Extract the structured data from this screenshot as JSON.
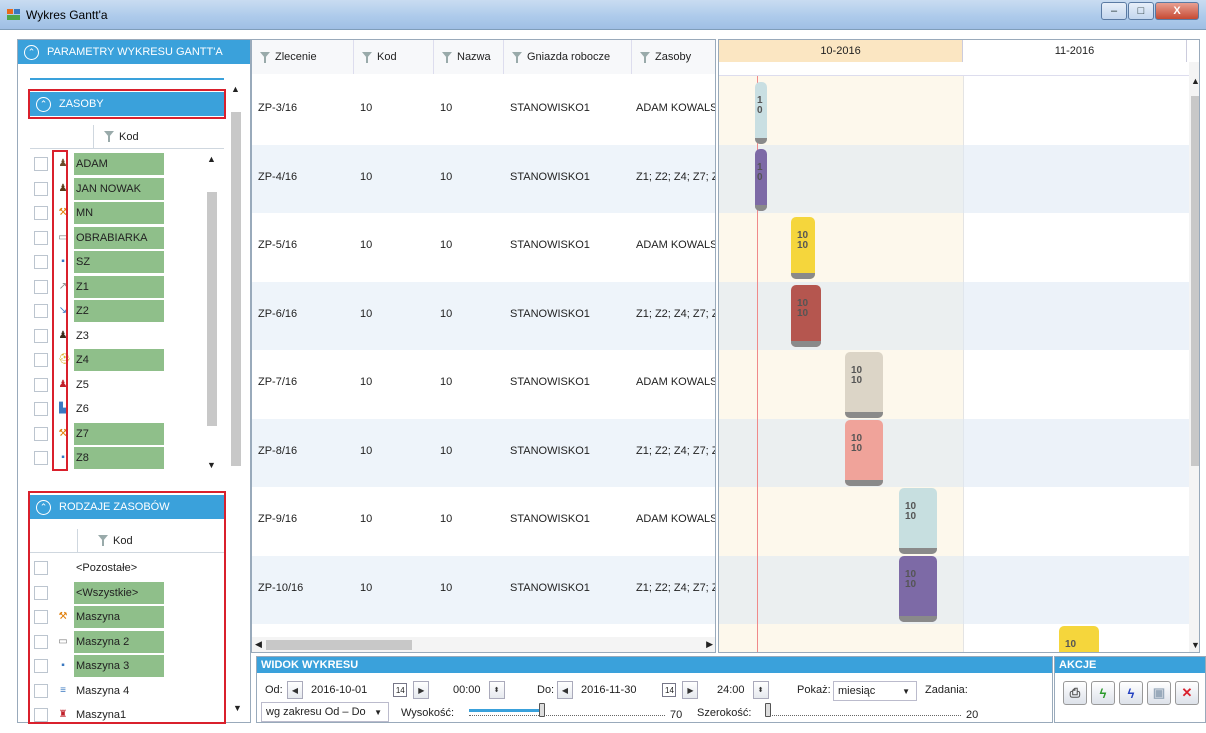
{
  "window": {
    "title": "Wykres Gantt'a",
    "minimize": "–",
    "maximize": "□",
    "close": "X"
  },
  "left": {
    "params_title": "PARAMETRY WYKRESU GANTT'A",
    "zasoby": {
      "title": "ZASOBY",
      "col": "Kod",
      "rows": [
        {
          "label": "ADAM KOWALSKI",
          "icon": "person-icon",
          "glyph": "♟",
          "color": "#6b4a2a",
          "green": true
        },
        {
          "label": "JAN NOWAK",
          "icon": "person-icon",
          "glyph": "♟",
          "color": "#5a3a1a",
          "green": true
        },
        {
          "label": "MN",
          "icon": "machine-icon",
          "glyph": "⚒",
          "color": "#e07a00",
          "green": true
        },
        {
          "label": "OBRABIARKA",
          "icon": "lathe-icon",
          "glyph": "▭",
          "color": "#777777",
          "green": true
        },
        {
          "label": "SZ",
          "icon": "device-icon",
          "glyph": "▪",
          "color": "#3a78c0",
          "green": true
        },
        {
          "label": "Z1",
          "icon": "tool-icon",
          "glyph": "↗",
          "color": "#888888",
          "green": true
        },
        {
          "label": "Z2",
          "icon": "tool-icon",
          "glyph": "↘",
          "color": "#3a78c0",
          "green": true
        },
        {
          "label": "Z3",
          "icon": "person-icon",
          "glyph": "♟",
          "color": "#3a2a1a",
          "green": false
        },
        {
          "label": "Z4",
          "icon": "worker-icon",
          "glyph": "⛑",
          "color": "#d4a000",
          "green": true
        },
        {
          "label": "Z5",
          "icon": "person-icon",
          "glyph": "♟",
          "color": "#c0202a",
          "green": false
        },
        {
          "label": "Z6",
          "icon": "chart-icon",
          "glyph": "▙",
          "color": "#3a78c0",
          "green": false
        },
        {
          "label": "Z7",
          "icon": "machine-icon",
          "glyph": "⚒",
          "color": "#e07a00",
          "green": true
        },
        {
          "label": "Z8",
          "icon": "device-icon",
          "glyph": "▪",
          "color": "#3a78c0",
          "green": true
        }
      ]
    },
    "rodzaje": {
      "title": "RODZAJE ZASOBÓW",
      "col": "Kod",
      "rows": [
        {
          "label": "<Pozostałe>",
          "icon": "",
          "glyph": "",
          "color": "#000000",
          "green": false
        },
        {
          "label": "<Wszystkie>",
          "icon": "",
          "glyph": "",
          "color": "#000000",
          "green": true
        },
        {
          "label": "Maszyna",
          "icon": "machine-icon",
          "glyph": "⚒",
          "color": "#e07a00",
          "green": true
        },
        {
          "label": "Maszyna 2",
          "icon": "lathe-icon",
          "glyph": "▭",
          "color": "#777777",
          "green": true
        },
        {
          "label": "Maszyna 3",
          "icon": "device-icon",
          "glyph": "▪",
          "color": "#3a78c0",
          "green": true
        },
        {
          "label": "Maszyna 4",
          "icon": "list-icon",
          "glyph": "≡",
          "color": "#3a78c0",
          "green": false
        },
        {
          "label": "Maszyna1",
          "icon": "robot-icon",
          "glyph": "♜",
          "color": "#c0202a",
          "green": false
        }
      ]
    }
  },
  "table": {
    "headers": [
      "Zlecenie",
      "Kod",
      "Nazwa",
      "Gniazda robocze",
      "Zasoby"
    ],
    "rows": [
      [
        "ZP-3/16",
        "10",
        "10",
        "STANOWISKO1",
        "ADAM KOWALS"
      ],
      [
        "ZP-4/16",
        "10",
        "10",
        "STANOWISKO1",
        "Z1; Z2; Z4; Z7; Z"
      ],
      [
        "ZP-5/16",
        "10",
        "10",
        "STANOWISKO1",
        "ADAM KOWALS"
      ],
      [
        "ZP-6/16",
        "10",
        "10",
        "STANOWISKO1",
        "Z1; Z2; Z4; Z7; Z"
      ],
      [
        "ZP-7/16",
        "10",
        "10",
        "STANOWISKO1",
        "ADAM KOWALS"
      ],
      [
        "ZP-8/16",
        "10",
        "10",
        "STANOWISKO1",
        "Z1; Z2; Z4; Z7; Z"
      ],
      [
        "ZP-9/16",
        "10",
        "10",
        "STANOWISKO1",
        "ADAM KOWALS"
      ],
      [
        "ZP-10/16",
        "10",
        "10",
        "STANOWISKO1",
        "Z1; Z2; Z4; Z7; Z"
      ]
    ]
  },
  "gantt": {
    "months": [
      "10-2016",
      "11-2016"
    ],
    "bars": [
      {
        "line1": "1",
        "line2": "0",
        "color": "#c9dfe2"
      },
      {
        "line1": "1",
        "line2": "0",
        "color": "#7d6aa6"
      },
      {
        "line1": "10",
        "line2": "10",
        "color": "#f5d63c"
      },
      {
        "line1": "10",
        "line2": "10",
        "color": "#b5564f"
      },
      {
        "line1": "10",
        "line2": "10",
        "color": "#dcd5c7"
      },
      {
        "line1": "10",
        "line2": "10",
        "color": "#f0a39a"
      },
      {
        "line1": "10",
        "line2": "10",
        "color": "#c7dfe0"
      },
      {
        "line1": "10",
        "line2": "10",
        "color": "#7d6aa6"
      },
      {
        "line1": "10",
        "line2": "",
        "color": "#f5d63c"
      }
    ]
  },
  "view": {
    "title": "WIDOK WYKRESU",
    "od_label": "Od:",
    "od_date": "2016-10-01",
    "od_time": "00:00",
    "do_label": "Do:",
    "do_date": "2016-11-30",
    "do_time": "24:00",
    "pokaz_label": "Pokaż:",
    "pokaz_value": "miesiąc",
    "zadania_label": "Zadania:",
    "range_mode": "wg zakresu Od – Do",
    "wysokosc_label": "Wysokość:",
    "wysokosc_value": "70",
    "wysokosc_level": 0.37,
    "szerokosc_label": "Szerokość:",
    "szerokosc_value": "20",
    "szerokosc_level": 0.0
  },
  "actions": {
    "title": "AKCJE"
  },
  "colors": {
    "accent": "#3aa1db",
    "green": "#8fbf8a",
    "highlight_red": "#d9202c"
  }
}
